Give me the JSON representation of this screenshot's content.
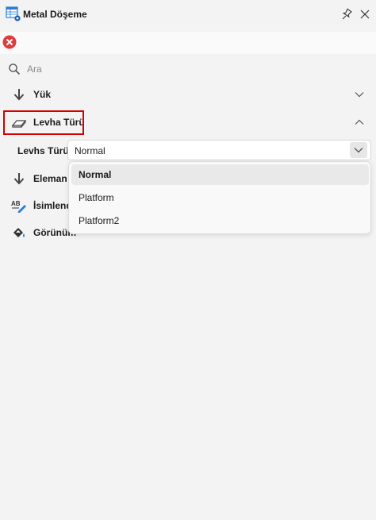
{
  "window": {
    "title": "Metal Döşeme",
    "title_icon": "table-gear-icon",
    "pin_icon": "pin-icon",
    "close_all_icon": "close-circle-icon"
  },
  "search": {
    "placeholder": "Ara",
    "value": ""
  },
  "sections": {
    "yuk": {
      "label": "Yük",
      "icon": "arrow-down-icon",
      "expanded": false
    },
    "levha": {
      "label": "Levha Türü",
      "icon": "plate-icon",
      "expanded": true
    },
    "eleman": {
      "label": "Eleman",
      "icon": "arrow-down-icon"
    },
    "isimlendirme": {
      "label": "İsimlend",
      "icon": "abc-pencil-icon"
    },
    "gorunum": {
      "label": "Görünüm",
      "icon": "paint-bucket-icon"
    }
  },
  "levha_props": {
    "label": "Levhs Türü",
    "selected": "Normal",
    "options": [
      "Normal",
      "Platform",
      "Platform2"
    ]
  },
  "colors": {
    "accent_blue": "#1a6fd1",
    "close_red": "#e0393e",
    "highlight_red": "#d40000"
  }
}
